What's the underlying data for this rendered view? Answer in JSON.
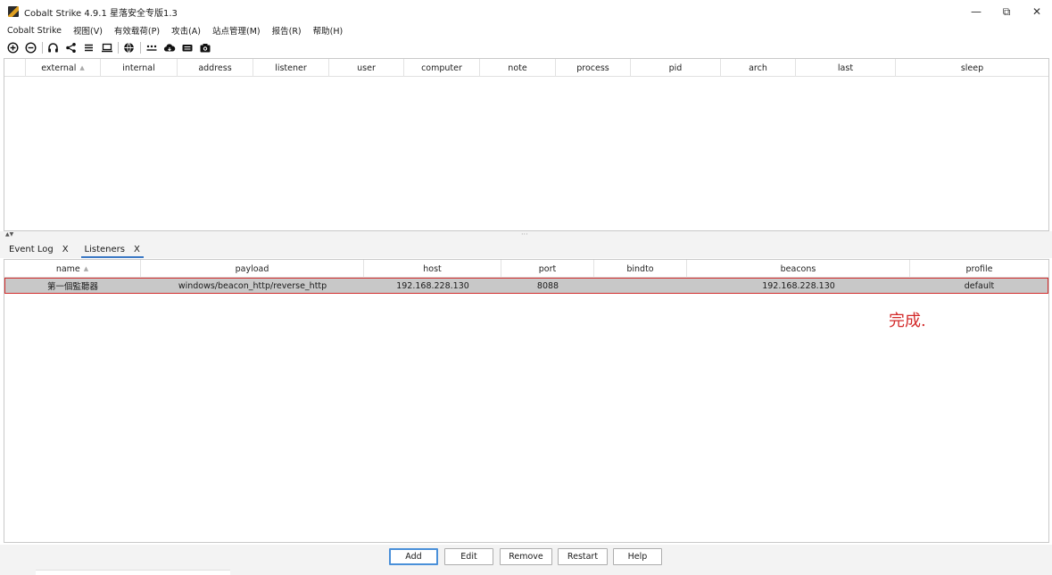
{
  "window": {
    "title": "Cobalt Strike 4.9.1 星落安全专版1.3",
    "controls": {
      "minimize": "—",
      "restore": "⧉",
      "close": "✕"
    }
  },
  "menu": {
    "items": [
      "Cobalt Strike",
      "视图(V)",
      "有效载荷(P)",
      "攻击(A)",
      "站点管理(M)",
      "报告(R)",
      "帮助(H)"
    ]
  },
  "toolbar": {
    "icons": [
      "plus-circle-icon",
      "minus-circle-icon",
      "headphones-icon",
      "share-icon",
      "list-icon",
      "laptop-icon",
      "globe-icon",
      "dots-bar-icon",
      "cloud-icon",
      "keyboard-icon",
      "camera-icon"
    ]
  },
  "beacons_table": {
    "columns": [
      {
        "label": "external",
        "sorted": true
      },
      {
        "label": "internal"
      },
      {
        "label": "address"
      },
      {
        "label": "listener"
      },
      {
        "label": "user"
      },
      {
        "label": "computer"
      },
      {
        "label": "note"
      },
      {
        "label": "process"
      },
      {
        "label": "pid"
      },
      {
        "label": "arch"
      },
      {
        "label": "last"
      },
      {
        "label": "sleep"
      }
    ]
  },
  "splitter": {
    "arrows": "▲▼",
    "grip": "···"
  },
  "tabs": [
    {
      "label": "Event Log",
      "close": "X"
    },
    {
      "label": "Listeners",
      "close": "X",
      "active": true
    }
  ],
  "listeners_table": {
    "columns": [
      {
        "label": "name",
        "sorted": true
      },
      {
        "label": "payload"
      },
      {
        "label": "host"
      },
      {
        "label": "port"
      },
      {
        "label": "bindto"
      },
      {
        "label": "beacons"
      },
      {
        "label": "profile"
      }
    ],
    "rows": [
      {
        "name": "第一個監聽器",
        "payload": "windows/beacon_http/reverse_http",
        "host": "192.168.228.130",
        "port": "8088",
        "bindto": "",
        "beacons": "192.168.228.130",
        "profile": "default"
      }
    ]
  },
  "annotation": "完成.",
  "sort_arrow": "▲",
  "buttons": [
    "Add",
    "Edit",
    "Remove",
    "Restart",
    "Help"
  ],
  "colors": {
    "selection_row": "#c8c8c8",
    "highlight_border": "#d22c2c",
    "annotation": "#d32a2a",
    "tab_underline": "#3b78c4"
  }
}
